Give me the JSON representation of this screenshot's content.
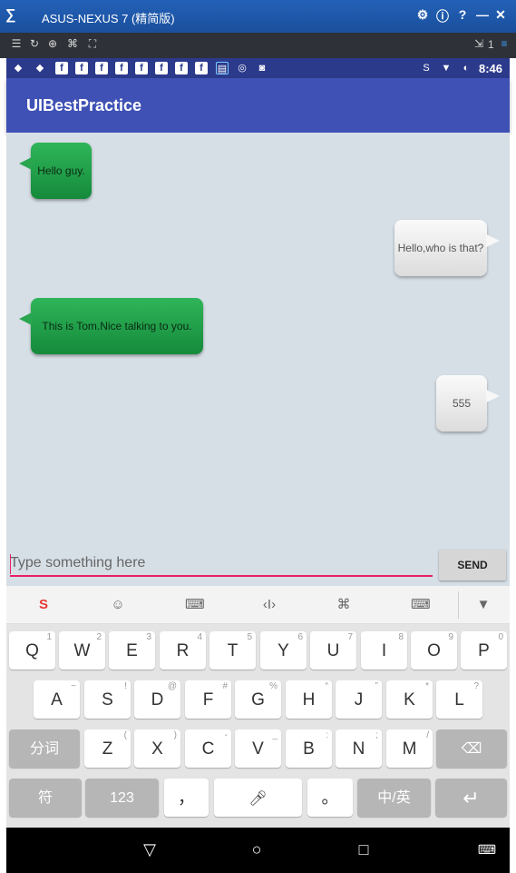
{
  "window": {
    "title": "ASUS-NEXUS 7 (精简版)",
    "logo": "∑sigma"
  },
  "toolbar": {
    "page_num": "1"
  },
  "status": {
    "time": "8:46"
  },
  "app": {
    "title": "UIBestPractice"
  },
  "messages": [
    {
      "text": "Hello guy.",
      "side": "received"
    },
    {
      "text": "Hello,who is that?",
      "side": "sent"
    },
    {
      "text": "This is Tom.Nice talking to you.",
      "side": "received"
    },
    {
      "text": "555",
      "side": "sent"
    }
  ],
  "input": {
    "placeholder": "Type something here",
    "value": ""
  },
  "send": {
    "label": "SEND"
  },
  "keyboard": {
    "row1": [
      {
        "key": "Q",
        "hint": "1"
      },
      {
        "key": "W",
        "hint": "2"
      },
      {
        "key": "E",
        "hint": "3"
      },
      {
        "key": "R",
        "hint": "4"
      },
      {
        "key": "T",
        "hint": "5"
      },
      {
        "key": "Y",
        "hint": "6"
      },
      {
        "key": "U",
        "hint": "7"
      },
      {
        "key": "I",
        "hint": "8"
      },
      {
        "key": "O",
        "hint": "9"
      },
      {
        "key": "P",
        "hint": "0"
      }
    ],
    "row2": [
      {
        "key": "A",
        "hint": "~"
      },
      {
        "key": "S",
        "hint": "!"
      },
      {
        "key": "D",
        "hint": "@"
      },
      {
        "key": "F",
        "hint": "#"
      },
      {
        "key": "G",
        "hint": "%"
      },
      {
        "key": "H",
        "hint": "“"
      },
      {
        "key": "J",
        "hint": "”"
      },
      {
        "key": "K",
        "hint": "*"
      },
      {
        "key": "L",
        "hint": "?"
      }
    ],
    "row3": [
      {
        "key": "Z",
        "hint": "("
      },
      {
        "key": "X",
        "hint": ")"
      },
      {
        "key": "C",
        "hint": "-"
      },
      {
        "key": "V",
        "hint": "_"
      },
      {
        "key": "B",
        "hint": ":"
      },
      {
        "key": "N",
        "hint": ";"
      },
      {
        "key": "M",
        "hint": "/"
      }
    ],
    "fenci": "分词",
    "fu": "符",
    "num": "123",
    "comma": "，",
    "period": "。",
    "lang": "中/英"
  },
  "colors": {
    "appbar": "#3f51b5",
    "statusbar": "#2c3a8c",
    "received_bubble": "#1f9e48",
    "accent": "#e91e63"
  }
}
